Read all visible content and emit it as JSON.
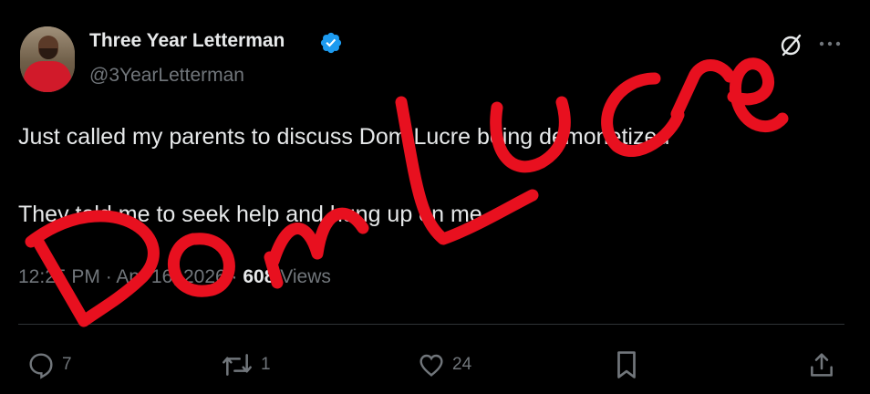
{
  "author": {
    "display_name": "Three Year Letterman",
    "handle": "@3YearLetterman",
    "verified_icon": "verified-badge-icon",
    "avatar": "avatar-photo"
  },
  "tweet": {
    "line1": "Just called my parents to discuss Dom Lucre being demonetized",
    "line2": "They told me to seek help and hung up on me"
  },
  "meta": {
    "time": "12:25 PM",
    "separator": "·",
    "date": "Apr 16, 2026",
    "separator2": "·",
    "views_count": "608",
    "views_label": "Views"
  },
  "actions": {
    "reply_count": "7",
    "retweet_count": "1",
    "like_count": "24"
  },
  "overlay": {
    "handwriting": "Dom Lucre",
    "color": "#e8101f"
  },
  "colors": {
    "background": "#000000",
    "text": "#e7e9ea",
    "secondary": "#71767b",
    "verified": "#1d9bf0"
  }
}
